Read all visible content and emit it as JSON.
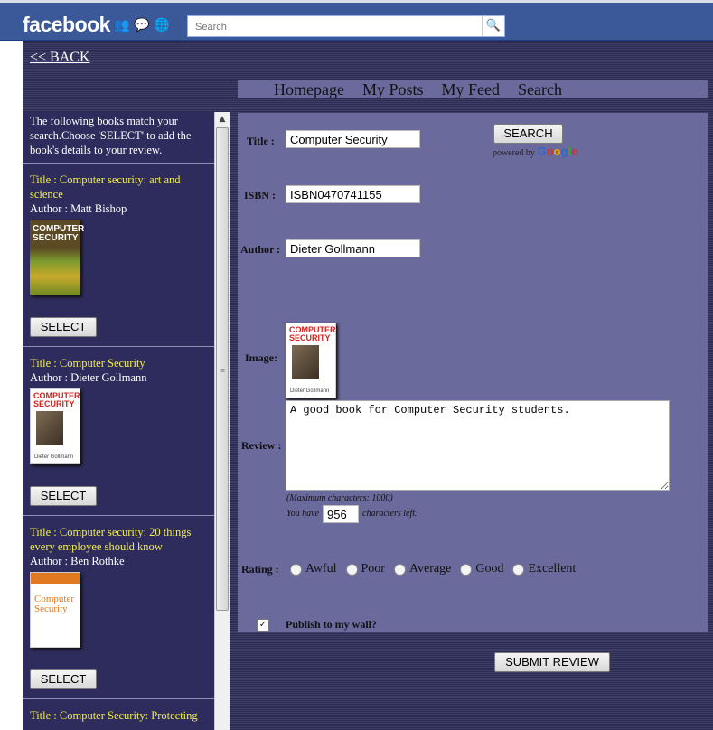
{
  "facebook": {
    "logo": "facebook",
    "search_placeholder": "Search"
  },
  "app": {
    "back_link": "<< BACK",
    "nav": [
      "Homepage",
      "My Posts",
      "My Feed",
      "Search"
    ]
  },
  "results": {
    "intro": "The following books match your search.Choose 'SELECT' to add the book's details to your review.",
    "select_label": "SELECT",
    "books": [
      {
        "title": "Title : Computer security: art and science",
        "author": "Author : Matt Bishop",
        "cover_text": "COMPUTER SECURITY"
      },
      {
        "title": "Title : Computer Security",
        "author": "Author : Dieter Gollmann",
        "cover_text": "COMPUTER SECURITY",
        "cover_author": "Dieter Gollmann"
      },
      {
        "title": "Title : Computer security: 20 things every employee should know",
        "author": "Author : Ben Rothke",
        "cover_text": "Computer Security"
      },
      {
        "title": "Title : Computer Security: Protecting",
        "author": "",
        "cover_text": ""
      }
    ]
  },
  "form": {
    "title_label": "Title :",
    "title_value": "Computer Security",
    "search_button": "SEARCH",
    "powered_by": "powered by",
    "google": [
      "G",
      "o",
      "o",
      "g",
      "l",
      "e"
    ],
    "isbn_label": "ISBN :",
    "isbn_value": "ISBN0470741155",
    "author_label": "Author :",
    "author_value": "Dieter Gollmann",
    "image_label": "Image:",
    "image_cover_text": "COMPUTER SECURITY",
    "image_cover_author": "Dieter Gollmann",
    "review_label": "Review :",
    "review_value": "A good book for Computer Security students.",
    "max_chars": "(Maximum characters: 1000)",
    "you_have": "You have",
    "chars_left_value": "956",
    "chars_left_suffix": "characters left.",
    "rating_label": "Rating :",
    "rating_options": [
      "Awful",
      "Poor",
      "Average",
      "Good",
      "Excellent"
    ],
    "publish_label": "Publish to my wall?",
    "publish_checked": true,
    "submit_button": "SUBMIT REVIEW"
  },
  "colors": {
    "facebook_blue": "#3b5998",
    "panel": "#6b6a9c",
    "left_list": "#2e2c5c",
    "book_title": "#f3ee4a"
  }
}
